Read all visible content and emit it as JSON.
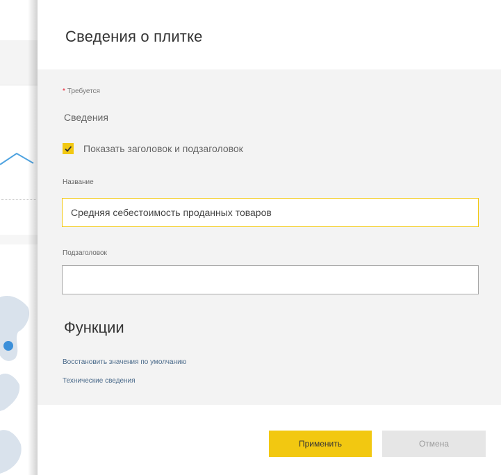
{
  "pane": {
    "title": "Сведения о плитке"
  },
  "form": {
    "required_note": "Требуется",
    "section_label": "Сведения",
    "show_title_checkbox": {
      "label": "Показать заголовок и подзаголовок",
      "checked": true
    },
    "title_field": {
      "label": "Название",
      "value": "Средняя себестоимость проданных товаров"
    },
    "subtitle_field": {
      "label": "Подзаголовок",
      "value": ""
    }
  },
  "functions": {
    "heading": "Функции",
    "links": [
      "Восстановить значения по умолчанию",
      "Технические сведения"
    ]
  },
  "buttons": {
    "apply": "Применить",
    "cancel": "Отмена"
  },
  "colors": {
    "accent": "#f2c811",
    "body_background": "#f3f3f3",
    "link": "#4a6a8a",
    "required_star": "#e81123"
  }
}
